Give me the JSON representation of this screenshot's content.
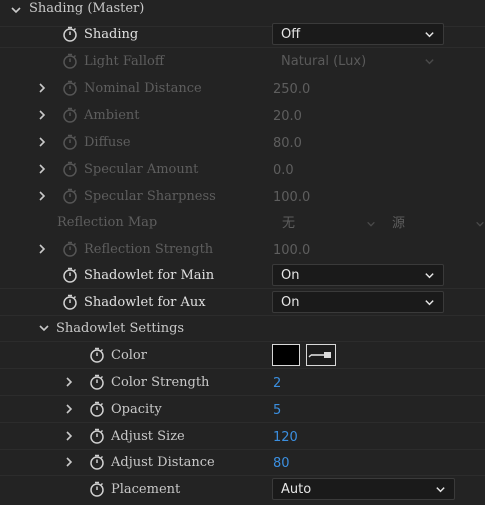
{
  "header": {
    "title": "Shading (Master)"
  },
  "rows": {
    "shading": {
      "label": "Shading",
      "value": "Off"
    },
    "light_falloff": {
      "label": "Light Falloff",
      "value": "Natural (Lux)"
    },
    "nominal_distance": {
      "label": "Nominal Distance",
      "value": "250.0"
    },
    "ambient": {
      "label": "Ambient",
      "value": "20.0"
    },
    "diffuse": {
      "label": "Diffuse",
      "value": "80.0"
    },
    "specular_amount": {
      "label": "Specular Amount",
      "value": "0.0"
    },
    "specular_sharpness": {
      "label": "Specular Sharpness",
      "value": "100.0"
    },
    "reflection_map": {
      "label": "Reflection Map",
      "value_a": "无",
      "value_b": "源"
    },
    "reflection_strength": {
      "label": "Reflection Strength",
      "value": "100.0"
    },
    "shadowlet_main": {
      "label": "Shadowlet for Main",
      "value": "On"
    },
    "shadowlet_aux": {
      "label": "Shadowlet for Aux",
      "value": "On"
    },
    "shadowlet_settings": {
      "label": "Shadowlet Settings"
    },
    "color": {
      "label": "Color",
      "swatch": "#000000"
    },
    "color_strength": {
      "label": "Color Strength",
      "value": "2"
    },
    "opacity": {
      "label": "Opacity",
      "value": "5"
    },
    "adjust_size": {
      "label": "Adjust Size",
      "value": "120"
    },
    "adjust_distance": {
      "label": "Adjust Distance",
      "value": "80"
    },
    "placement": {
      "label": "Placement",
      "value": "Auto"
    }
  },
  "colors": {
    "background": "#232323",
    "text": "#c9c9c9",
    "disabled_text": "#5e5e5e",
    "value_blue": "#3b8fe0"
  },
  "icons": {
    "expand": "chevron-right-icon",
    "collapse": "chevron-down-icon",
    "stopwatch": "stopwatch-icon",
    "dropdown": "chevron-down-icon",
    "eyedropper": "eyedropper-icon"
  }
}
